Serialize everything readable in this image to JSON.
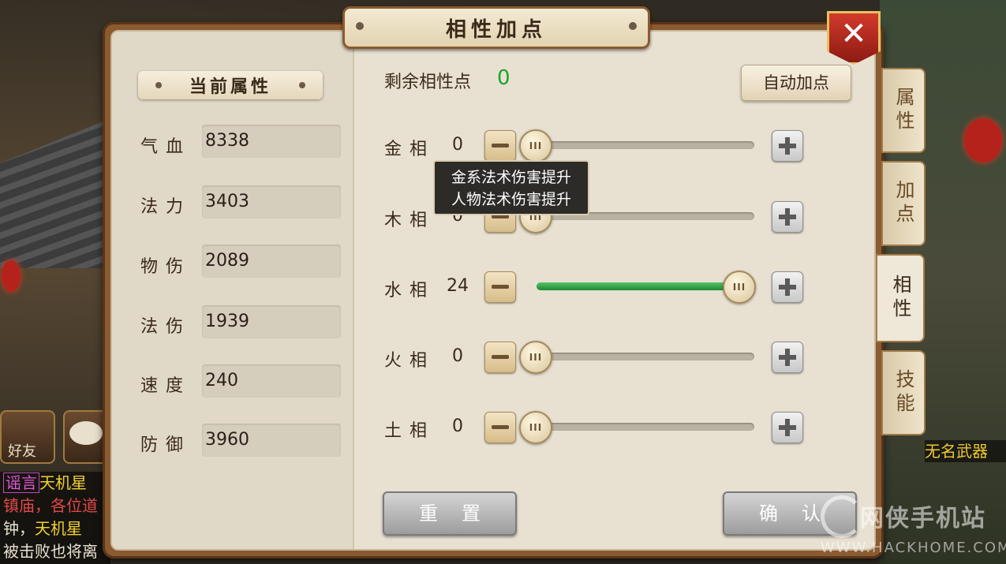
{
  "dialog": {
    "title": "相性加点",
    "close_label": "✕"
  },
  "current_attrs": {
    "header": "当前属性",
    "rows": [
      {
        "label": "气血",
        "value": "8338"
      },
      {
        "label": "法力",
        "value": "3403"
      },
      {
        "label": "物伤",
        "value": "2089"
      },
      {
        "label": "法伤",
        "value": "1939"
      },
      {
        "label": "速度",
        "value": "240"
      },
      {
        "label": "防御",
        "value": "3960"
      }
    ]
  },
  "points": {
    "remaining_label": "剩余相性点",
    "remaining_value": "0",
    "auto_button": "自动加点"
  },
  "elements": [
    {
      "label": "金相",
      "value": "0",
      "max": 24
    },
    {
      "label": "木相",
      "value": "0",
      "max": 24
    },
    {
      "label": "水相",
      "value": "24",
      "max": 24
    },
    {
      "label": "火相",
      "value": "0",
      "max": 24
    },
    {
      "label": "土相",
      "value": "0",
      "max": 24
    }
  ],
  "slider_knob_glyph": "III",
  "tooltip": {
    "line1": "金系法术伤害提升",
    "line2": "人物法术伤害提升"
  },
  "buttons": {
    "reset": "重置",
    "confirm": "确认"
  },
  "tabs": [
    {
      "label": "属性",
      "active": false
    },
    {
      "label": "加点",
      "active": false
    },
    {
      "label": "相性",
      "active": true
    },
    {
      "label": "技能",
      "active": false
    }
  ],
  "background": {
    "friend_label": "好友",
    "weapon_label": "无名武器",
    "chat": [
      {
        "tag": "谣言",
        "name": "天机星",
        "text": ""
      },
      {
        "text": "镇庙，各位道"
      },
      {
        "text": "钟，",
        "name": "天机星"
      },
      {
        "text": "被击败也将离"
      }
    ]
  },
  "watermark": {
    "cn": "网侠手机站",
    "url": "WWW.HACKHOME.COM"
  },
  "colors": {
    "remaining_value": "#1fa22a",
    "slider_fill": "#2fa544",
    "close_red": "#c0281e"
  }
}
